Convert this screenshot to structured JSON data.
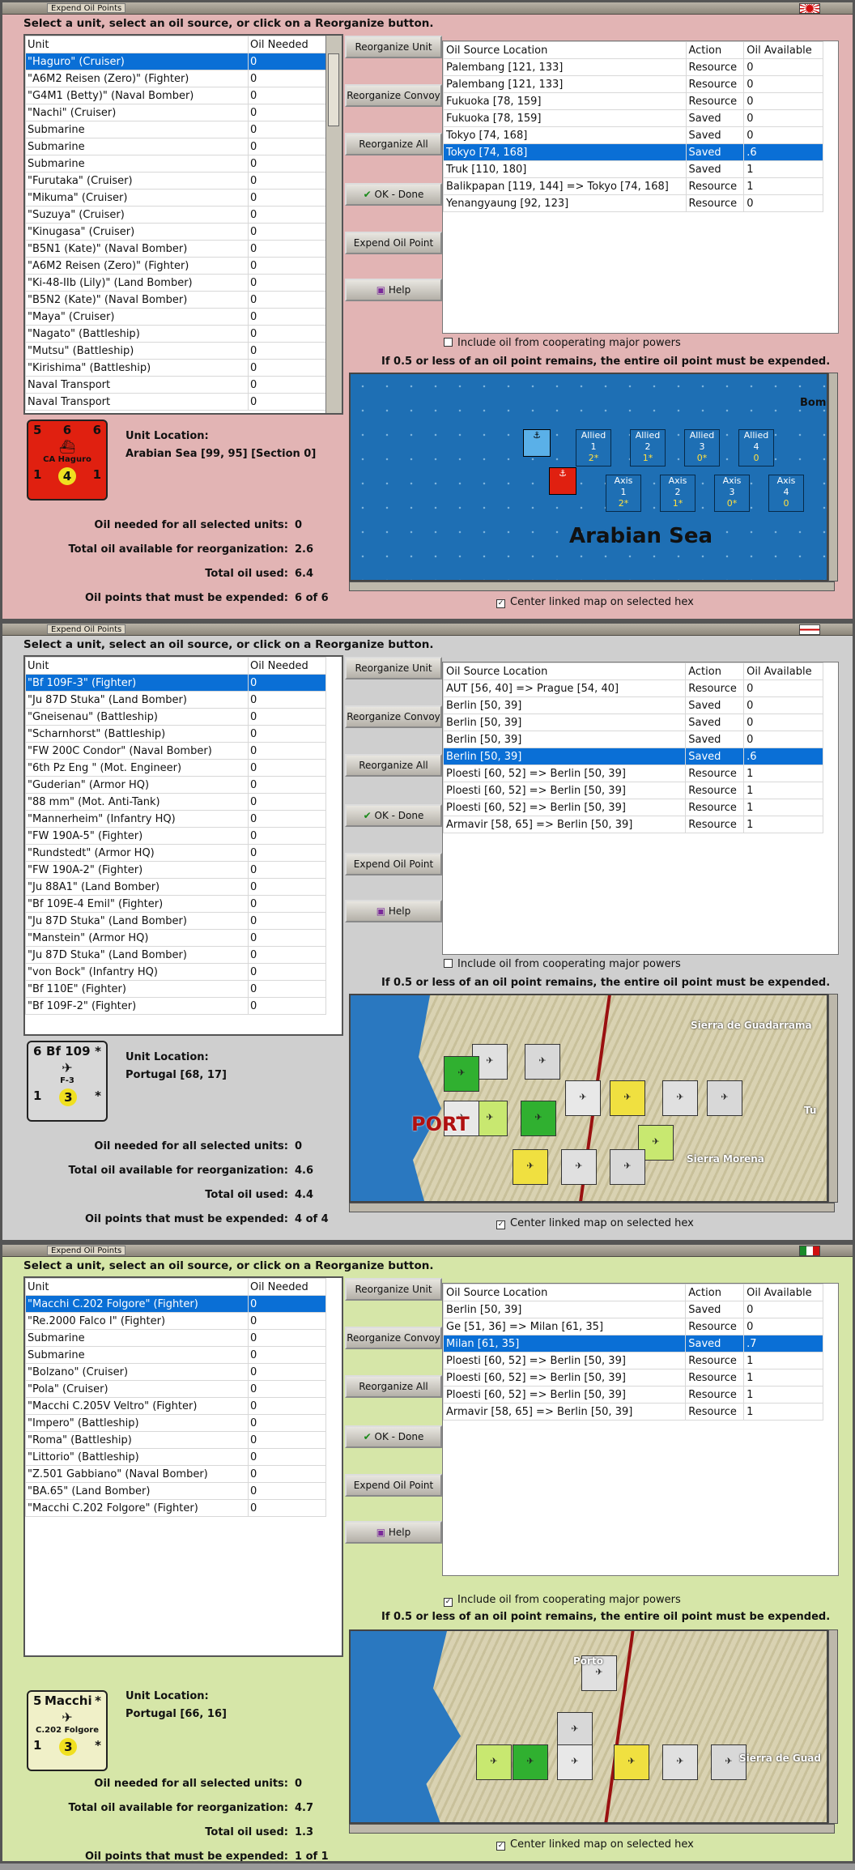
{
  "windows": [
    {
      "title": "Expend Oil Points",
      "instruction": "Select a unit, select an oil source, or click on a Reorganize button.",
      "bg": "#e2b4b4",
      "unit_header": [
        "Unit",
        "Oil Needed"
      ],
      "units": [
        [
          "\"Haguro\" (Cruiser)",
          "0"
        ],
        [
          "\"A6M2 Reisen (Zero)\" (Fighter)",
          "0"
        ],
        [
          "\"G4M1 (Betty)\" (Naval Bomber)",
          "0"
        ],
        [
          "\"Nachi\" (Cruiser)",
          "0"
        ],
        [
          "Submarine",
          "0"
        ],
        [
          "Submarine",
          "0"
        ],
        [
          "Submarine",
          "0"
        ],
        [
          "\"Furutaka\" (Cruiser)",
          "0"
        ],
        [
          "\"Mikuma\" (Cruiser)",
          "0"
        ],
        [
          "\"Suzuya\" (Cruiser)",
          "0"
        ],
        [
          "\"Kinugasa\" (Cruiser)",
          "0"
        ],
        [
          "\"B5N1 (Kate)\" (Naval Bomber)",
          "0"
        ],
        [
          "\"A6M2 Reisen (Zero)\" (Fighter)",
          "0"
        ],
        [
          "\"Ki-48-IIb (Lily)\" (Land Bomber)",
          "0"
        ],
        [
          "\"B5N2 (Kate)\" (Naval Bomber)",
          "0"
        ],
        [
          "\"Maya\" (Cruiser)",
          "0"
        ],
        [
          "\"Nagato\" (Battleship)",
          "0"
        ],
        [
          "\"Mutsu\" (Battleship)",
          "0"
        ],
        [
          "\"Kirishima\" (Battleship)",
          "0"
        ],
        [
          "Naval Transport",
          "0"
        ],
        [
          "Naval Transport",
          "0"
        ]
      ],
      "selected_unit": 0,
      "buttons": [
        "Reorganize Unit",
        "Reorganize Convoy",
        "Reorganize All",
        "OK - Done",
        "Expend Oil Point",
        "Help"
      ],
      "oil_header": [
        "Oil Source Location",
        "Action",
        "Oil Available"
      ],
      "oil_rows": [
        [
          "Palembang [121, 133]",
          "Resource",
          "0"
        ],
        [
          "Palembang [121, 133]",
          "Resource",
          "0"
        ],
        [
          "Fukuoka [78, 159]",
          "Resource",
          "0"
        ],
        [
          "Fukuoka [78, 159]",
          "Saved",
          "0"
        ],
        [
          "Tokyo [74, 168]",
          "Saved",
          "0"
        ],
        [
          "Tokyo [74, 168]",
          "Saved",
          ".6"
        ],
        [
          "Truk [110, 180]",
          "Saved",
          "1"
        ],
        [
          "Balikpapan [119, 144] => Tokyo [74, 168]",
          "Resource",
          "1"
        ],
        [
          "Yenangyaung [92, 123]",
          "Resource",
          "0"
        ]
      ],
      "selected_oil": 5,
      "cooperate_label": "Include oil from cooperating major powers",
      "cooperate_checked": false,
      "note": "If 0.5 or less of an oil point remains, the entire oil point must be expended.",
      "center_label": "Center linked map on selected hex",
      "unit_location_label": "Unit Location:",
      "unit_location": "Arabian Sea [99, 95] [Section 0]",
      "counter": {
        "top": [
          "5",
          "6",
          "6"
        ],
        "name": "CA Haguro",
        "bottom": [
          "1",
          "4",
          "1"
        ],
        "color": "#e02010"
      },
      "stats": [
        [
          "Oil needed for all selected units:",
          "0"
        ],
        [
          "Total oil available for reorganization:",
          "2.6"
        ],
        [
          "Total oil used:",
          "6.4"
        ],
        [
          "Oil points that must be expended:",
          "6 of 6"
        ]
      ],
      "map": {
        "type": "sea",
        "sea_label": "Arabian Sea",
        "corner_label": "Bom",
        "boxes": [
          [
            "Allied",
            "1",
            "2*"
          ],
          [
            "Allied",
            "2",
            "1*"
          ],
          [
            "Allied",
            "3",
            "0*"
          ],
          [
            "Allied",
            "4",
            "0"
          ],
          [
            "Axis",
            "1",
            "2*"
          ],
          [
            "Axis",
            "2",
            "1*"
          ],
          [
            "Axis",
            "3",
            "0*"
          ],
          [
            "Axis",
            "4",
            "0"
          ]
        ]
      }
    },
    {
      "title": "Expend Oil Points",
      "instruction": "Select a unit, select an oil source, or click on a Reorganize button.",
      "bg": "#cfcfcf",
      "unit_header": [
        "Unit",
        "Oil Needed"
      ],
      "units": [
        [
          "\"Bf 109F-3\" (Fighter)",
          "0"
        ],
        [
          "\"Ju 87D Stuka\" (Land Bomber)",
          "0"
        ],
        [
          "\"Gneisenau\" (Battleship)",
          "0"
        ],
        [
          "\"Scharnhorst\" (Battleship)",
          "0"
        ],
        [
          "\"FW 200C Condor\" (Naval Bomber)",
          "0"
        ],
        [
          "\"6th Pz Eng \" (Mot. Engineer)",
          "0"
        ],
        [
          "\"Guderian\" (Armor HQ)",
          "0"
        ],
        [
          "\"88 mm\" (Mot. Anti-Tank)",
          "0"
        ],
        [
          "\"Mannerheim\" (Infantry HQ)",
          "0"
        ],
        [
          "\"FW 190A-5\" (Fighter)",
          "0"
        ],
        [
          "\"Rundstedt\" (Armor HQ)",
          "0"
        ],
        [
          "\"FW 190A-2\" (Fighter)",
          "0"
        ],
        [
          "\"Ju 88A1\" (Land Bomber)",
          "0"
        ],
        [
          "\"Bf 109E-4 Emil\" (Fighter)",
          "0"
        ],
        [
          "\"Ju 87D Stuka\" (Land Bomber)",
          "0"
        ],
        [
          "\"Manstein\" (Armor HQ)",
          "0"
        ],
        [
          "\"Ju 87D Stuka\" (Land Bomber)",
          "0"
        ],
        [
          "\"von Bock\" (Infantry HQ)",
          "0"
        ],
        [
          "\"Bf 110E\" (Fighter)",
          "0"
        ],
        [
          "\"Bf 109F-2\" (Fighter)",
          "0"
        ]
      ],
      "selected_unit": 0,
      "buttons": [
        "Reorganize Unit",
        "Reorganize Convoy",
        "Reorganize All",
        "OK - Done",
        "Expend Oil Point",
        "Help"
      ],
      "oil_header": [
        "Oil Source Location",
        "Action",
        "Oil Available"
      ],
      "oil_rows": [
        [
          "AUT [56, 40] => Prague [54, 40]",
          "Resource",
          "0"
        ],
        [
          "Berlin [50, 39]",
          "Saved",
          "0"
        ],
        [
          "Berlin [50, 39]",
          "Saved",
          "0"
        ],
        [
          "Berlin [50, 39]",
          "Saved",
          "0"
        ],
        [
          "Berlin [50, 39]",
          "Saved",
          ".6"
        ],
        [
          "Ploesti [60, 52] => Berlin [50, 39]",
          "Resource",
          "1"
        ],
        [
          "Ploesti [60, 52] => Berlin [50, 39]",
          "Resource",
          "1"
        ],
        [
          "Ploesti [60, 52] => Berlin [50, 39]",
          "Resource",
          "1"
        ],
        [
          "Armavir [58, 65] => Berlin [50, 39]",
          "Resource",
          "1"
        ]
      ],
      "selected_oil": 4,
      "cooperate_label": "Include oil from cooperating major powers",
      "cooperate_checked": false,
      "note": "If 0.5 or less of an oil point remains, the entire oil point must be expended.",
      "center_label": "Center linked map on selected hex",
      "unit_location_label": "Unit Location:",
      "unit_location": "Portugal [68, 17]",
      "counter": {
        "top": [
          "6",
          "Bf 109",
          "*"
        ],
        "name": "F-3",
        "bottom": [
          "1",
          "3",
          "*"
        ],
        "color": "#d8d8d8"
      },
      "stats": [
        [
          "Oil needed for all selected units:",
          "0"
        ],
        [
          "Total oil available for reorganization:",
          "4.6"
        ],
        [
          "Total oil used:",
          "4.4"
        ],
        [
          "Oil points that must be expended:",
          "4 of 4"
        ]
      ],
      "map": {
        "type": "land",
        "labels": [
          "Sierra de Guadarrama",
          "PORT",
          "Sierra Morena",
          "Tu"
        ]
      }
    },
    {
      "title": "Expend Oil Points",
      "instruction": "Select a unit, select an oil source, or click on a Reorganize button.",
      "bg": "#d6e6a8",
      "unit_header": [
        "Unit",
        "Oil Needed"
      ],
      "units": [
        [
          "\"Macchi C.202 Folgore\" (Fighter)",
          "0"
        ],
        [
          "\"Re.2000 Falco I\" (Fighter)",
          "0"
        ],
        [
          "Submarine",
          "0"
        ],
        [
          "Submarine",
          "0"
        ],
        [
          "\"Bolzano\" (Cruiser)",
          "0"
        ],
        [
          "\"Pola\" (Cruiser)",
          "0"
        ],
        [
          "\"Macchi C.205V Veltro\" (Fighter)",
          "0"
        ],
        [
          "\"Impero\" (Battleship)",
          "0"
        ],
        [
          "\"Roma\" (Battleship)",
          "0"
        ],
        [
          "\"Littorio\" (Battleship)",
          "0"
        ],
        [
          "\"Z.501 Gabbiano\" (Naval Bomber)",
          "0"
        ],
        [
          "\"BA.65\" (Land Bomber)",
          "0"
        ],
        [
          "\"Macchi C.202 Folgore\" (Fighter)",
          "0"
        ]
      ],
      "selected_unit": 0,
      "buttons": [
        "Reorganize Unit",
        "Reorganize Convoy",
        "Reorganize All",
        "OK - Done",
        "Expend Oil Point",
        "Help"
      ],
      "oil_header": [
        "Oil Source Location",
        "Action",
        "Oil Available"
      ],
      "oil_rows": [
        [
          "Berlin [50, 39]",
          "Saved",
          "0"
        ],
        [
          "Ge [51, 36] => Milan [61, 35]",
          "Resource",
          "0"
        ],
        [
          "Milan [61, 35]",
          "Saved",
          ".7"
        ],
        [
          "Ploesti [60, 52] => Berlin [50, 39]",
          "Resource",
          "1"
        ],
        [
          "Ploesti [60, 52] => Berlin [50, 39]",
          "Resource",
          "1"
        ],
        [
          "Ploesti [60, 52] => Berlin [50, 39]",
          "Resource",
          "1"
        ],
        [
          "Armavir [58, 65] => Berlin [50, 39]",
          "Resource",
          "1"
        ]
      ],
      "selected_oil": 2,
      "cooperate_label": "Include oil from cooperating major powers",
      "cooperate_checked": true,
      "note": "If 0.5 or less of an oil point remains, the entire oil point must be expended.",
      "center_label": "Center linked map on selected hex",
      "unit_location_label": "Unit Location:",
      "unit_location": "Portugal [66, 16]",
      "counter": {
        "top": [
          "5",
          "Macchi",
          "*"
        ],
        "name": "C.202 Folgore",
        "bottom": [
          "1",
          "3",
          "*"
        ],
        "color": "#f0f0c8"
      },
      "stats": [
        [
          "Oil needed for all selected units:",
          "0"
        ],
        [
          "Total oil available for reorganization:",
          "4.7"
        ],
        [
          "Total oil used:",
          "1.3"
        ],
        [
          "Oil points that must be expended:",
          "1 of 1"
        ]
      ],
      "map": {
        "type": "land",
        "labels": [
          "Porto",
          "Sierra de Guad"
        ]
      }
    }
  ]
}
